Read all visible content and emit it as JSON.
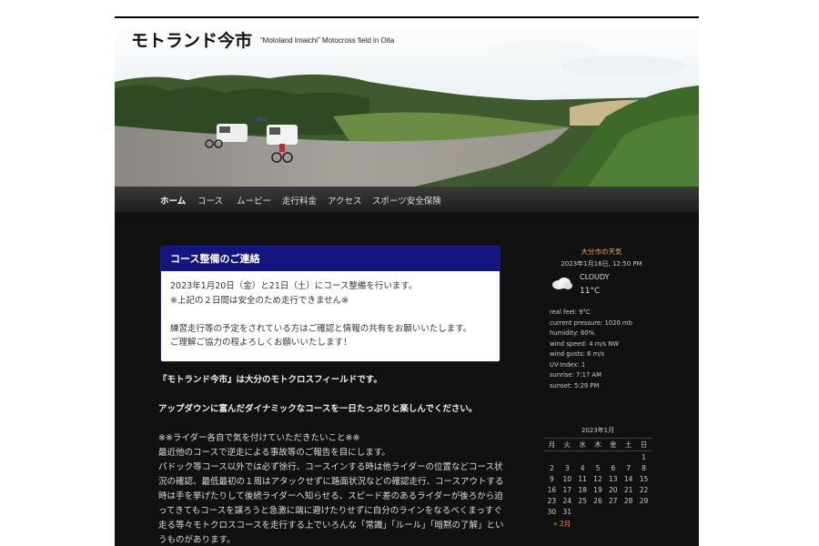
{
  "site": {
    "title": "モトランド今市",
    "tagline": "“Motoland Imaichi” Motocross field in Oita"
  },
  "nav": {
    "items": [
      "ホーム",
      "コース",
      "ムービー",
      "走行料金",
      "アクセス",
      "スポーツ安全保険"
    ]
  },
  "notice": {
    "title": "コース整備のご連絡",
    "lines": [
      "2023年1月20日（金）と21日（土）にコース整備を行います。",
      "※上記の２日間は安全のため走行できません※",
      "",
      "練習走行等の予定をされている方はご確認と情報の共有をお願いいたします。",
      "ご理解ご協力の程よろしくお願いいたします！"
    ]
  },
  "main": {
    "intro": "『モトランド今市』は大分のモトクロスフィールドです。",
    "intro2": "アップダウンに富んだダイナミックなコースを一日たっぷりと楽しんでください。",
    "rules_title": "※※ライダー各自で気を付けていただきたいこと※※",
    "rules_line1": "最近他のコースで逆走による事故等のご報告を目にします。",
    "rules_line2": "パドック等コース以外では必ず徐行、コースインする時は他ライダーの位置などコース状況の確認、最低最初の１周はアタックせずに路面状況などの確認走行、コースアウトする時は手を挙げたりして後続ライダーへ知らせる、スピード差のあるライダーが後ろから迫ってきてもコースを譲ろうと急激に端に避けたりせずに自分のラインをなるべくまっすぐ走る等々モトクロスコースを走行する上でいろんな「常識」「ルール」「暗黙の了解」というものがあります。"
  },
  "weather": {
    "city": "大分市の天気",
    "date": "2023年1月16日, 12:50 PM",
    "icon": "cloud-icon",
    "condition": "CLOUDY",
    "temp": "11°C",
    "details": [
      "real feel: 9°C",
      "current pressure: 1020 mb",
      "humidity: 60%",
      "wind speed: 4 m/s NW",
      "wind gusts: 6 m/s",
      "UV-Index: 1",
      "sunrise: 7:17 AM",
      "sunset: 5:29 PM"
    ]
  },
  "calendar": {
    "caption": "2023年1月",
    "weekdays": [
      "月",
      "火",
      "水",
      "木",
      "金",
      "土",
      "日"
    ],
    "rows": [
      [
        "",
        "",
        "",
        "",
        "",
        "",
        "1"
      ],
      [
        "2",
        "3",
        "4",
        "5",
        "6",
        "7",
        "8"
      ],
      [
        "9",
        "10",
        "11",
        "12",
        "13",
        "14",
        "15"
      ],
      [
        "16",
        "17",
        "18",
        "19",
        "20",
        "21",
        "22"
      ],
      [
        "23",
        "24",
        "25",
        "26",
        "27",
        "28",
        "29"
      ],
      [
        "30",
        "31",
        "",
        "",
        "",
        "",
        ""
      ]
    ],
    "prev": "« 2月"
  }
}
